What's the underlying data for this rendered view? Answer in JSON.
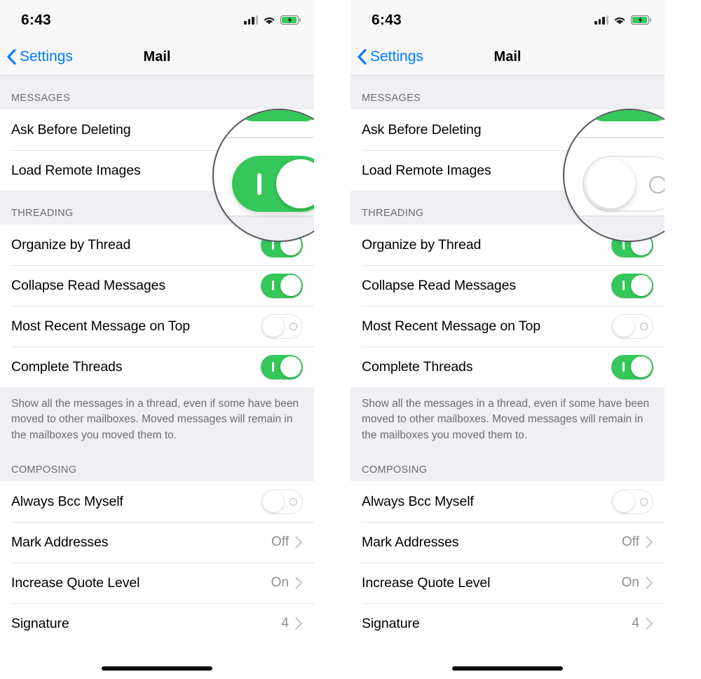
{
  "panels": [
    {
      "id": "left",
      "magnifier": {
        "state_label": "on",
        "icon": "toggle-switch-on-icon"
      }
    },
    {
      "id": "right",
      "magnifier": {
        "state_label": "off",
        "icon": "toggle-switch-off-icon"
      }
    }
  ],
  "status_bar": {
    "time": "6:43",
    "signal_icon": "cellular-signal-icon",
    "wifi_icon": "wifi-icon",
    "battery_icon": "battery-charging-icon"
  },
  "nav": {
    "back_label": "Settings",
    "back_icon": "chevron-left-icon",
    "title": "Mail"
  },
  "sections": [
    {
      "header": "MESSAGES",
      "rows": [
        {
          "label": "Ask Before Deleting",
          "control": "toggle",
          "state": "on"
        },
        {
          "label": "Load Remote Images",
          "control": "toggle",
          "state": "on"
        }
      ]
    },
    {
      "header": "THREADING",
      "rows": [
        {
          "label": "Organize by Thread",
          "control": "toggle",
          "state": "on"
        },
        {
          "label": "Collapse Read Messages",
          "control": "toggle",
          "state": "on"
        },
        {
          "label": "Most Recent Message on Top",
          "control": "toggle",
          "state": "off"
        },
        {
          "label": "Complete Threads",
          "control": "toggle",
          "state": "on"
        }
      ],
      "footer": "Show all the messages in a thread, even if some have been moved to other mailboxes. Moved messages will remain in the mailboxes you moved them to."
    },
    {
      "header": "COMPOSING",
      "rows": [
        {
          "label": "Always Bcc Myself",
          "control": "toggle",
          "state": "off"
        },
        {
          "label": "Mark Addresses",
          "control": "disclosure",
          "value": "Off"
        },
        {
          "label": "Increase Quote Level",
          "control": "disclosure",
          "value": "On"
        },
        {
          "label": "Signature",
          "control": "disclosure",
          "value": "4"
        }
      ]
    }
  ],
  "colors": {
    "accent_blue": "#007AFF",
    "toggle_green": "#35C759",
    "group_bg": "#EFEFF4",
    "row_bg": "#FFFFFF",
    "secondary_text": "#8E8E93",
    "magnifier_ring": "#58585C"
  },
  "home_indicator_icon": "home-indicator-bar"
}
